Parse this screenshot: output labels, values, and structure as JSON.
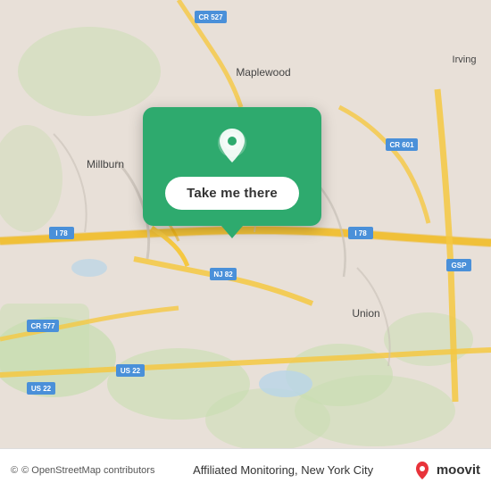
{
  "map": {
    "background_color": "#e8e0d8",
    "popup": {
      "button_label": "Take me there",
      "pin_color": "white"
    },
    "places": [
      "Maplewood",
      "Millburn",
      "Union",
      "Irving"
    ],
    "roads": [
      "I 78",
      "I 78",
      "NJ 82",
      "CR 601",
      "CR 577",
      "US 22",
      "US 22",
      "GSP",
      "CR 527"
    ]
  },
  "bottom_bar": {
    "attribution": "© OpenStreetMap contributors",
    "location_name": "Affiliated Monitoring, New York City",
    "app_name": "moovit"
  }
}
